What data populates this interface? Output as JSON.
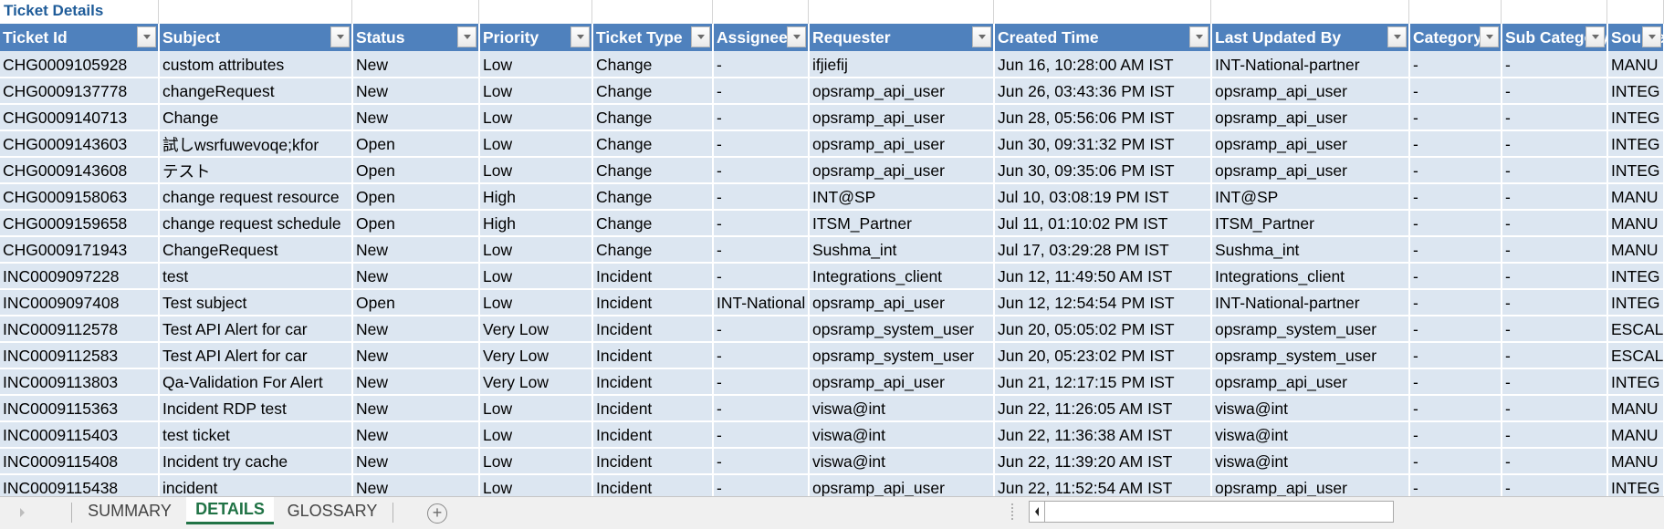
{
  "sheet": {
    "title": "Ticket Details",
    "columns": [
      "Ticket Id",
      "Subject",
      "Status",
      "Priority",
      "Ticket Type",
      "Assignee",
      "Requester",
      "Created Time",
      "Last Updated By",
      "Category",
      "Sub Category",
      "Source"
    ],
    "rows": [
      [
        "CHG0009105928",
        "custom attributes",
        "New",
        "Low",
        "Change",
        "-",
        "ifjiefij",
        "Jun 16, 10:28:00 AM IST",
        "INT-National-partner",
        "-",
        "-",
        "MANU"
      ],
      [
        "CHG0009137778",
        "changeRequest",
        "New",
        "Low",
        "Change",
        "-",
        "opsramp_api_user",
        "Jun 26, 03:43:36 PM IST",
        "opsramp_api_user",
        "-",
        "-",
        "INTEG"
      ],
      [
        "CHG0009140713",
        "Change",
        "New",
        "Low",
        "Change",
        "-",
        "opsramp_api_user",
        "Jun 28, 05:56:06 PM IST",
        "opsramp_api_user",
        "-",
        "-",
        "INTEG"
      ],
      [
        "CHG0009143603",
        "試しwsrfuwevoqe;kfor",
        "Open",
        "Low",
        "Change",
        "-",
        "opsramp_api_user",
        "Jun 30, 09:31:32 PM IST",
        "opsramp_api_user",
        "-",
        "-",
        "INTEG"
      ],
      [
        "CHG0009143608",
        "テスト",
        "Open",
        "Low",
        "Change",
        "-",
        "opsramp_api_user",
        "Jun 30, 09:35:06 PM IST",
        "opsramp_api_user",
        "-",
        "-",
        "INTEG"
      ],
      [
        "CHG0009158063",
        "change request resource",
        "Open",
        "High",
        "Change",
        "-",
        "INT@SP",
        "Jul 10, 03:08:19 PM IST",
        "INT@SP",
        "-",
        "-",
        "MANU"
      ],
      [
        "CHG0009159658",
        "change request schedule",
        "Open",
        "High",
        "Change",
        "-",
        "ITSM_Partner",
        "Jul 11, 01:10:02 PM IST",
        "ITSM_Partner",
        "-",
        "-",
        "MANU"
      ],
      [
        "CHG0009171943",
        "ChangeRequest",
        "New",
        "Low",
        "Change",
        "-",
        "Sushma_int",
        "Jul 17, 03:29:28 PM IST",
        "Sushma_int",
        "-",
        "-",
        "MANU"
      ],
      [
        "INC0009097228",
        "test",
        "New",
        "Low",
        "Incident",
        "-",
        "Integrations_client",
        "Jun 12, 11:49:50 AM IST",
        "Integrations_client",
        "-",
        "-",
        "INTEG"
      ],
      [
        "INC0009097408",
        "Test subject",
        "Open",
        "Low",
        "Incident",
        "INT-National",
        "opsramp_api_user",
        "Jun 12, 12:54:54 PM IST",
        "INT-National-partner",
        "-",
        "-",
        "INTEG"
      ],
      [
        "INC0009112578",
        "Test API Alert for car",
        "New",
        "Very Low",
        "Incident",
        "-",
        "opsramp_system_user",
        "Jun 20, 05:05:02 PM IST",
        "opsramp_system_user",
        "-",
        "-",
        "ESCAL"
      ],
      [
        "INC0009112583",
        "Test API Alert for car",
        "New",
        "Very Low",
        "Incident",
        "-",
        "opsramp_system_user",
        "Jun 20, 05:23:02 PM IST",
        "opsramp_system_user",
        "-",
        "-",
        "ESCAL"
      ],
      [
        "INC0009113803",
        "Qa-Validation For Alert",
        "New",
        "Very Low",
        "Incident",
        "-",
        "opsramp_api_user",
        "Jun 21, 12:17:15 PM IST",
        "opsramp_api_user",
        "-",
        "-",
        "INTEG"
      ],
      [
        "INC0009115363",
        "Incident RDP test",
        "New",
        "Low",
        "Incident",
        "-",
        "viswa@int",
        "Jun 22, 11:26:05 AM IST",
        "viswa@int",
        "-",
        "-",
        "MANU"
      ],
      [
        "INC0009115403",
        "test ticket",
        "New",
        "Low",
        "Incident",
        "-",
        "viswa@int",
        "Jun 22, 11:36:38 AM IST",
        "viswa@int",
        "-",
        "-",
        "MANU"
      ],
      [
        "INC0009115408",
        "Incident try cache",
        "New",
        "Low",
        "Incident",
        "-",
        "viswa@int",
        "Jun 22, 11:39:20 AM IST",
        "viswa@int",
        "-",
        "-",
        "MANU"
      ],
      [
        "INC0009115438",
        "incident",
        "New",
        "Low",
        "Incident",
        "-",
        "opsramp_api_user",
        "Jun 22, 11:52:54 AM IST",
        "opsramp_api_user",
        "-",
        "-",
        "INTEG"
      ]
    ]
  },
  "tabs": [
    {
      "label": "SUMMARY",
      "active": false
    },
    {
      "label": "DETAILS",
      "active": true
    },
    {
      "label": "GLOSSARY",
      "active": false
    }
  ],
  "add_sheet_label": "+",
  "colors": {
    "header_bg": "#4f81bd",
    "row_bg": "#dce6f1",
    "title_color": "#1f5c99",
    "active_tab": "#217346"
  }
}
